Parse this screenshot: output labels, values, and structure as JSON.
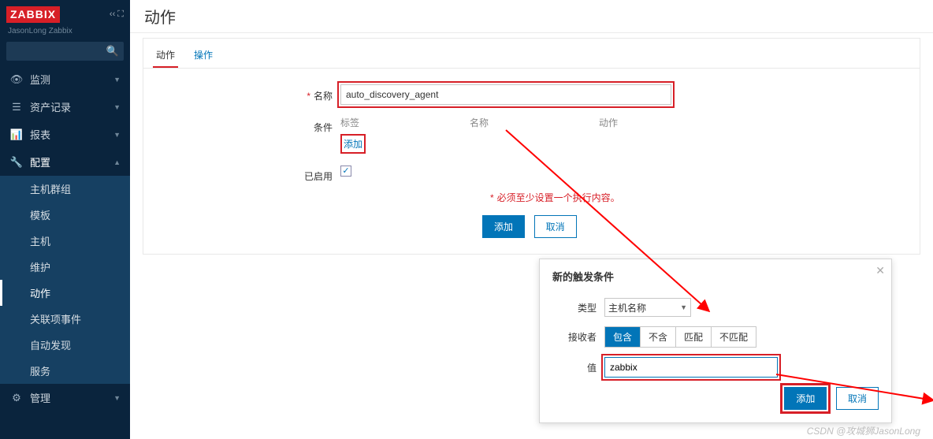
{
  "brand": {
    "logo": "ZABBIX",
    "subtitle": "JasonLong Zabbix"
  },
  "sidebar": {
    "search_placeholder": "",
    "groups": [
      {
        "label": "监测",
        "icon": "eye"
      },
      {
        "label": "资产记录",
        "icon": "list"
      },
      {
        "label": "报表",
        "icon": "chart"
      },
      {
        "label": "配置",
        "icon": "wrench",
        "expanded": true,
        "items": [
          "主机群组",
          "模板",
          "主机",
          "维护",
          "动作",
          "关联项事件",
          "自动发现",
          "服务"
        ],
        "active_index": 4
      },
      {
        "label": "管理",
        "icon": "gear"
      }
    ]
  },
  "page": {
    "title": "动作"
  },
  "tabs": [
    "动作",
    "操作"
  ],
  "form": {
    "name_label": "名称",
    "name_value": "auto_discovery_agent",
    "cond_label": "条件",
    "cond_cols": {
      "tag": "标签",
      "name": "名称",
      "action": "动作"
    },
    "add_link": "添加",
    "enabled_label": "已启用",
    "required_msg": "必须至少设置一个执行内容。",
    "submit": "添加",
    "cancel": "取消"
  },
  "modal": {
    "title": "新的触发条件",
    "type_label": "类型",
    "type_value": "主机名称",
    "operator_label": "接收者",
    "operators": [
      "包含",
      "不含",
      "匹配",
      "不匹配"
    ],
    "operator_selected": 0,
    "value_label": "值",
    "value_value": "zabbix",
    "submit": "添加",
    "cancel": "取消"
  },
  "watermark": "CSDN @攻城狮JasonLong"
}
